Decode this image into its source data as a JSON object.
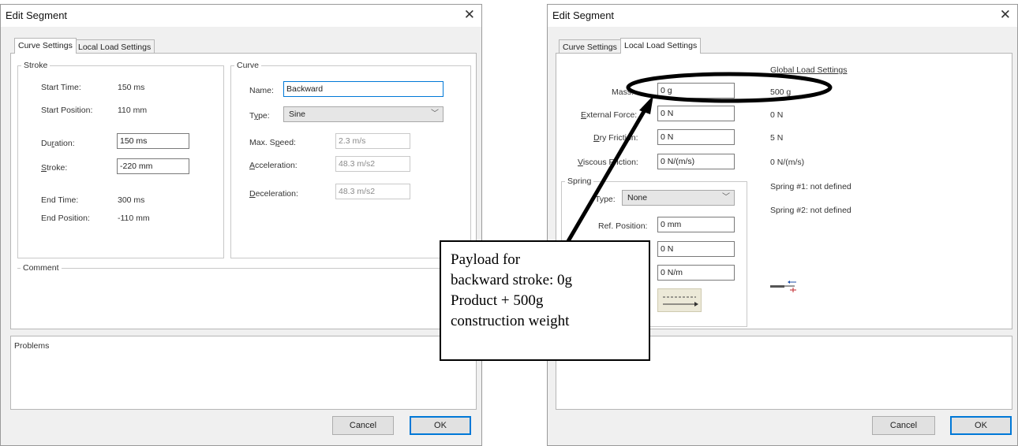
{
  "left_dialog": {
    "title": "Edit Segment",
    "close_glyph": "✕",
    "tabs": [
      {
        "label": "Curve Settings",
        "active": true
      },
      {
        "label": "Local Load Settings",
        "active": false
      }
    ],
    "stroke_group": {
      "legend": "Stroke",
      "start_time_label": "Start Time:",
      "start_time_value": "150 ms",
      "start_position_label": "Start Position:",
      "start_position_value": "110 mm",
      "duration_label_pre": "Du",
      "duration_label_u": "r",
      "duration_label_post": "ation:",
      "duration_value": "150 ms",
      "stroke_label_u": "S",
      "stroke_label_post": "troke:",
      "stroke_value": "-220 mm",
      "end_time_label": "End Time:",
      "end_time_value": "300 ms",
      "end_position_label": "End Position:",
      "end_position_value": "-110 mm"
    },
    "curve_group": {
      "legend": "Curve",
      "name_label": "Name:",
      "name_value": "Backward",
      "type_label_pre": "T",
      "type_label_u": "y",
      "type_label_post": "pe:",
      "type_value": "Sine",
      "max_speed_label_pre": "Max. S",
      "max_speed_label_u": "p",
      "max_speed_label_post": "eed:",
      "max_speed_value": "2.3 m/s",
      "acceleration_label_u": "A",
      "acceleration_label_post": "cceleration:",
      "acceleration_value": "48.3 m/s2",
      "deceleration_label_u": "D",
      "deceleration_label_post": "eceleration:",
      "deceleration_value": "48.3 m/s2"
    },
    "comment_legend": "Comment",
    "problems_label": "Problems",
    "cancel_label": "Cancel",
    "ok_label": "OK"
  },
  "right_dialog": {
    "title": "Edit Segment",
    "close_glyph": "✕",
    "tabs": [
      {
        "label": "Curve Settings",
        "active": false
      },
      {
        "label": "Local Load Settings",
        "active": true
      }
    ],
    "global_header": "Global Load Settings",
    "mass_label": "Mass:",
    "mass_value": "0 g",
    "mass_global": "500 g",
    "external_force_label_u": "E",
    "external_force_label_post": "xternal Force:",
    "external_force_value": "0 N",
    "external_force_global": "0 N",
    "dry_friction_label_u": "D",
    "dry_friction_label_post": "ry Friction:",
    "dry_friction_value": "0 N",
    "dry_friction_global": "5 N",
    "viscous_friction_label_u": "V",
    "viscous_friction_label_post": "iscous Friction:",
    "viscous_friction_value": "0 N/(m/s)",
    "viscous_friction_global": "0 N/(m/s)",
    "spring_legend": "Spring",
    "spring_type_label": "Type:",
    "spring_type_value": "None",
    "ref_position_label": "Ref. Position:",
    "ref_position_value": "0 mm",
    "spring_force_value": "0 N",
    "spring_rate_value": "0 N/m",
    "spring1_global": "Spring #1: not defined",
    "spring2_global": "Spring #2: not defined",
    "cancel_label": "Cancel",
    "ok_label": "OK"
  },
  "annotation": {
    "lines": [
      "Payload for",
      "backward stroke: 0g",
      "Product + 500g",
      "construction weight"
    ]
  }
}
